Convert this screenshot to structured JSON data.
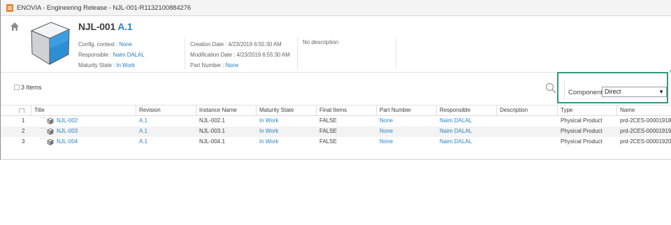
{
  "window": {
    "title": "ENOVIA - Engineering Release - NJL-001-R1132100884276"
  },
  "header": {
    "name": "NJL-001",
    "revision": "A.1",
    "config_label": "Config. context :",
    "config_value": "None",
    "responsible_label": "Responsible :",
    "responsible_value": "Naim DALAL",
    "maturity_label": "Maturity State :",
    "maturity_value": "In Work",
    "creation": "Creation Date : 4/23/2019 6:55:30 AM",
    "modification": "Modification Date : 4/23/2019 6:55:30 AM",
    "part_number_label": "Part Number :",
    "part_number_value": "None",
    "description": "No description"
  },
  "toolbar": {
    "items_count": "3 Items",
    "components_label": "Components",
    "components_value": "Direct"
  },
  "table": {
    "columns": [
      "Title",
      "Revision",
      "Instance Name",
      "Maturity State",
      "Final Items",
      "Part Number",
      "Responsible",
      "Description",
      "Type",
      "Name"
    ],
    "rows": [
      {
        "num": "1",
        "title": "NJL-002",
        "revision": "A.1",
        "instance": "NJL-002.1",
        "maturity": "In Work",
        "final": "FALSE",
        "part_number": "None",
        "responsible": "Naim DALAL",
        "description": "",
        "type": "Physical Product",
        "name": "prd-2CES-00001918"
      },
      {
        "num": "2",
        "title": "NJL-003",
        "revision": "A.1",
        "instance": "NJL-003.1",
        "maturity": "In Work",
        "final": "FALSE",
        "part_number": "None",
        "responsible": "Naim DALAL",
        "description": "",
        "type": "Physical Product",
        "name": "prd-2CES-00001919"
      },
      {
        "num": "3",
        "title": "NJL-004",
        "revision": "A.1",
        "instance": "NJL-004.1",
        "maturity": "In Work",
        "final": "FALSE",
        "part_number": "None",
        "responsible": "Naim DALAL",
        "description": "",
        "type": "Physical Product",
        "name": "prd-2CES-00001920"
      }
    ]
  },
  "colors": {
    "link": "#2a84c4",
    "highlight": "#2e9b7a",
    "app_icon": "#e8822e"
  },
  "icons": {
    "app": "enovia-app-icon",
    "home": "home-icon",
    "search": "search-icon",
    "part": "physical-product-icon",
    "thumbnail": "product-cube-thumbnail"
  }
}
